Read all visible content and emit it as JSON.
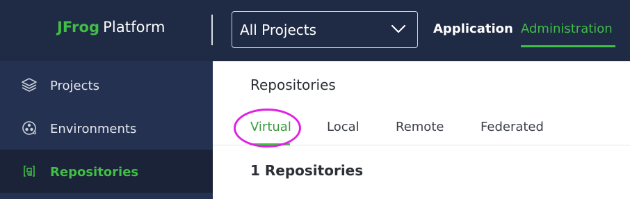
{
  "header": {
    "logo_brand": "JFrog",
    "logo_product": "Platform",
    "project_selector": "All Projects",
    "nav": [
      {
        "label": "Application"
      },
      {
        "label": "Administration"
      }
    ],
    "active_nav": "Administration",
    "accent_color": "#40be46"
  },
  "sidebar": {
    "items": [
      {
        "label": "Projects",
        "icon": "layers-icon"
      },
      {
        "label": "Environments",
        "icon": "environments-icon"
      },
      {
        "label": "Repositories",
        "icon": "repositories-icon"
      }
    ],
    "active_item": "Repositories"
  },
  "main": {
    "title": "Repositories",
    "tabs": [
      {
        "label": "Virtual"
      },
      {
        "label": "Local"
      },
      {
        "label": "Remote"
      },
      {
        "label": "Federated"
      }
    ],
    "active_tab": "Virtual",
    "count_text": "1 Repositories",
    "annotation_color": "#e020e4"
  }
}
